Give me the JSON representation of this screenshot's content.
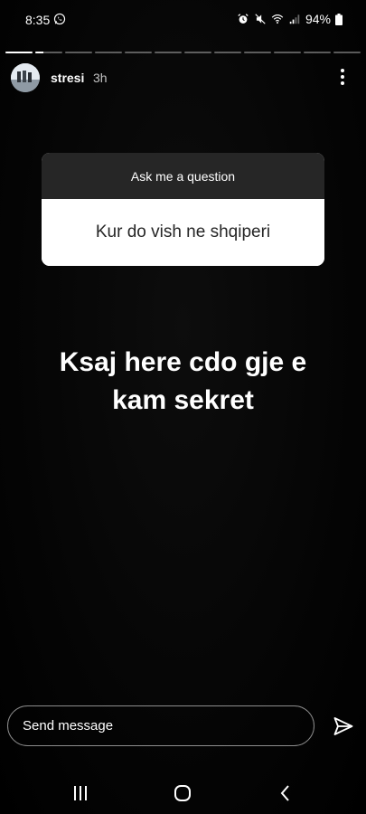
{
  "status_bar": {
    "time": "8:35",
    "battery_text": "94%"
  },
  "story": {
    "segment_count": 12,
    "active_segment_index": 1,
    "active_segment_progress": 0.3,
    "username": "stresi",
    "timestamp": "3h"
  },
  "question_sticker": {
    "header": "Ask me a question",
    "question": "Kur do vish ne shqiperi"
  },
  "answer": {
    "line1": "Ksaj here cdo gje e",
    "line2": "kam sekret"
  },
  "reply": {
    "placeholder": "Send message"
  },
  "colors": {
    "background": "#000000",
    "sticker_header": "#262626",
    "sticker_body": "#ffffff",
    "text": "#ffffff"
  },
  "icons": {
    "whatsapp": "whatsapp-icon",
    "alarm": "alarm-icon",
    "mute": "mute-icon",
    "wifi": "wifi-icon",
    "signal": "signal-icon",
    "battery": "battery-icon",
    "more": "more-vertical-icon",
    "send": "send-icon",
    "recent": "recent-apps-icon",
    "home": "home-icon",
    "back": "back-icon"
  }
}
